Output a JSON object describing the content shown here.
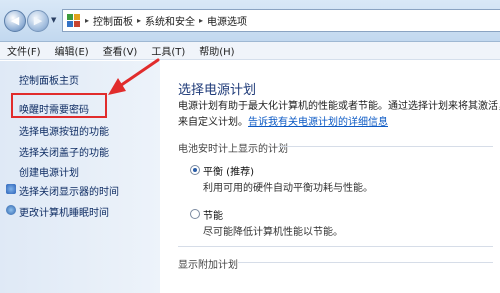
{
  "address": {
    "crumbs": [
      "控制面板",
      "系统和安全",
      "电源选项"
    ],
    "separator": "▸"
  },
  "menu": [
    "文件(F)",
    "编辑(E)",
    "查看(V)",
    "工具(T)",
    "帮助(H)"
  ],
  "sidebar": {
    "items": [
      {
        "label": "控制面板主页"
      },
      {
        "label": "唤醒时需要密码"
      },
      {
        "label": "选择电源按钮的功能"
      },
      {
        "label": "选择关闭盖子的功能"
      },
      {
        "label": "创建电源计划"
      },
      {
        "label": "选择关闭显示器的时间"
      },
      {
        "label": "更改计算机睡眠时间"
      }
    ]
  },
  "main": {
    "title": "选择电源计划",
    "desc_line1": "电源计划有助于最大化计算机的性能或者节能。通过选择计划来将其激活，",
    "desc_line2_prefix": "来自定义计划。",
    "desc_link": "告诉我有关电源计划的详细信息",
    "section_battery": "电池安时计上显示的计划",
    "plans": [
      {
        "name": "平衡 (推荐)",
        "desc": "利用可用的硬件自动平衡功耗与性能。",
        "selected": true
      },
      {
        "name": "节能",
        "desc": "尽可能降低计算机性能以节能。",
        "selected": false
      }
    ],
    "section_extra": "显示附加计划"
  },
  "colors": {
    "accent": "#0b59c4",
    "highlight": "#e12c2c"
  }
}
